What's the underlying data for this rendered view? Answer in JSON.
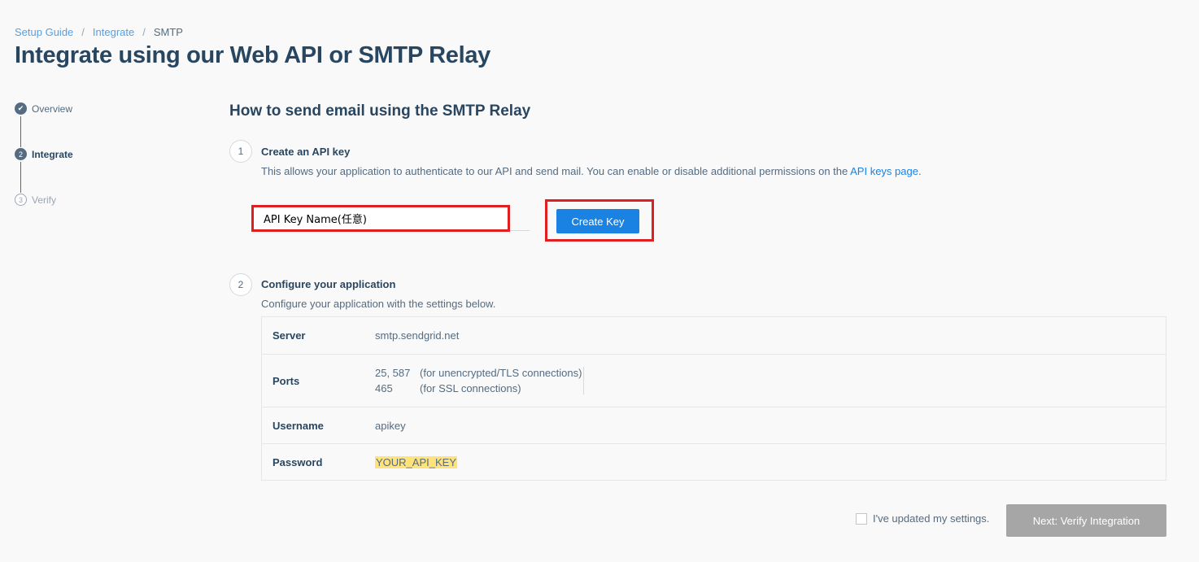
{
  "breadcrumb": {
    "items": [
      "Setup Guide",
      "Integrate"
    ],
    "separator": "/",
    "current": "SMTP"
  },
  "page_title": "Integrate using our Web API or SMTP Relay",
  "stepper": {
    "overview": {
      "label": "Overview",
      "icon": "check-icon",
      "glyph": "✔"
    },
    "integrate": {
      "label": "Integrate",
      "number": "2"
    },
    "verify": {
      "label": "Verify",
      "number": "3"
    }
  },
  "section_title": "How to send email using the SMTP Relay",
  "step1": {
    "number": "1",
    "heading": "Create an API key",
    "desc_before": "This allows your application to authenticate to our API and send mail. You can enable or disable additional permissions on the ",
    "desc_link": "API keys page",
    "desc_after": ".",
    "input_value": "API Key Name(任意)",
    "button_label": "Create Key"
  },
  "step2": {
    "number": "2",
    "heading": "Configure your application",
    "desc": "Configure your application with the settings below."
  },
  "settings": {
    "server": {
      "label": "Server",
      "value": "smtp.sendgrid.net"
    },
    "ports": {
      "label": "Ports",
      "entries": [
        {
          "port": "25, 587",
          "note": "(for unencrypted/TLS connections)"
        },
        {
          "port": "465",
          "note": "(for SSL connections)"
        }
      ]
    },
    "username": {
      "label": "Username",
      "value": "apikey"
    },
    "password": {
      "label": "Password",
      "value": "YOUR_API_KEY"
    }
  },
  "footer": {
    "checkbox_label": "I've updated my settings.",
    "next_button": "Next: Verify Integration"
  },
  "colors": {
    "accent": "#1a82e2",
    "highlight_border": "#e02020",
    "token_highlight": "#ffe27a",
    "disabled_button": "#a6a6a6"
  }
}
